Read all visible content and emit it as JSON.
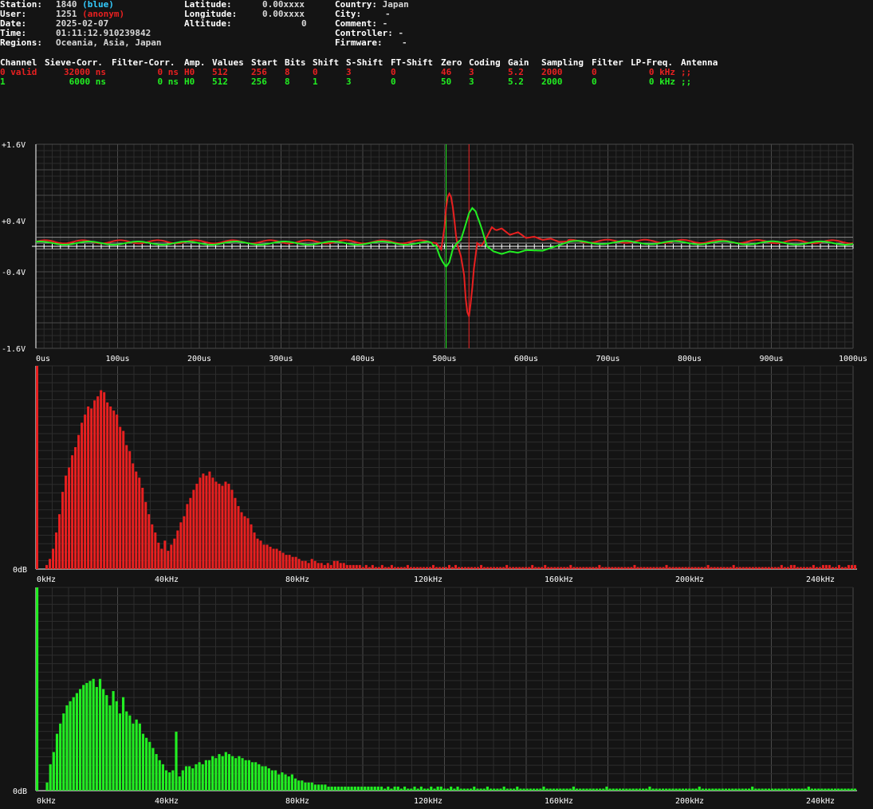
{
  "station": {
    "station_label": "Station:",
    "station_value": "1840",
    "station_tag": "(blue)",
    "user_label": "User:",
    "user_value": "1251",
    "user_tag": "(anonym)",
    "date_label": "Date:",
    "date_value": "2025-02-07",
    "time_label": "Time:",
    "time_value": "01:11:12.910239842",
    "regions_label": "Regions:",
    "regions_value": "Oceania, Asia, Japan",
    "latitude_label": "Latitude:",
    "latitude_value": "0.00xxxx",
    "longitude_label": "Longitude:",
    "longitude_value": "0.00xxxx",
    "altitude_label": "Altitude:",
    "altitude_value": "0",
    "country_label": "Country:",
    "country_value": "Japan",
    "city_label": "City:",
    "city_value": "-",
    "comment_label": "Comment:",
    "comment_value": "-",
    "controller_label": "Controller:",
    "controller_value": "-",
    "firmware_label": "Firmware:",
    "firmware_value": "-"
  },
  "channels": {
    "headers": [
      "Channel",
      "Sieve-Corr.",
      "Filter-Corr.",
      "Amp.",
      "Values",
      "Start",
      "Bits",
      "Shift",
      "S-Shift",
      "FT-Shift",
      "Zero",
      "Coding",
      "Gain",
      "Sampling",
      "Filter",
      "LP-Freq.",
      "Antenna"
    ],
    "rows": [
      {
        "color": "#e82020",
        "cells": [
          "0 valid",
          "32000 ns",
          "0 ns",
          "H0",
          "512",
          "256",
          "8",
          "0",
          "3",
          "0",
          "46",
          "3",
          "5.2",
          "2000",
          "0",
          "0 kHz",
          ";;"
        ]
      },
      {
        "color": "#22ee22",
        "cells": [
          "1",
          "6000 ns",
          "0 ns",
          "H0",
          "512",
          "256",
          "8",
          "1",
          "3",
          "0",
          "50",
          "3",
          "5.2",
          "2000",
          "0",
          "0 kHz",
          ";;"
        ]
      }
    ]
  },
  "colors": {
    "ch0": "#e82020",
    "ch1": "#22ee22",
    "grid": "#3a3a3a",
    "background": "#141414"
  },
  "chart_data": [
    {
      "type": "line",
      "x_unit": "us",
      "xlim": [
        0,
        1000
      ],
      "ylim": [
        -1.6,
        1.6
      ],
      "y_tick_labels": [
        {
          "value": 1.6,
          "label": "+1.6V"
        },
        {
          "value": 0.4,
          "label": "+0.4V"
        },
        {
          "value": -0.4,
          "label": "-0.4V"
        },
        {
          "value": -1.6,
          "label": "-1.6V"
        }
      ],
      "x_tick_labels": [
        "0us",
        "100us",
        "200us",
        "300us",
        "400us",
        "500us",
        "600us",
        "700us",
        "800us",
        "900us",
        "1000us"
      ],
      "markers_us": [
        {
          "x": 502,
          "color": "#22ee22"
        },
        {
          "x": 530,
          "color": "#e82020"
        }
      ],
      "series": [
        {
          "color": "#e82020",
          "x": [
            0,
            480,
            490,
            496,
            500,
            503,
            507,
            511,
            515,
            520,
            524,
            527,
            530,
            533,
            536,
            540,
            545,
            552,
            558,
            563,
            570,
            580,
            590,
            600,
            610,
            620,
            630,
            640,
            660,
            1000
          ],
          "y": [
            0.07,
            0.07,
            0.05,
            -0.05,
            0.3,
            0.75,
            0.85,
            0.55,
            0.05,
            -0.15,
            -0.45,
            -1.0,
            -1.1,
            -0.8,
            -0.35,
            0.05,
            0.0,
            0.15,
            0.3,
            0.25,
            0.28,
            0.18,
            0.22,
            0.13,
            0.15,
            0.1,
            0.12,
            0.07,
            0.08,
            0.07
          ]
        },
        {
          "color": "#22ee22",
          "x": [
            0,
            480,
            490,
            494,
            498,
            502,
            506,
            510,
            515,
            520,
            525,
            530,
            534,
            538,
            545,
            552,
            560,
            570,
            580,
            590,
            600,
            620,
            650,
            1000
          ],
          "y": [
            0.05,
            0.05,
            0.0,
            -0.15,
            -0.25,
            -0.32,
            -0.25,
            -0.05,
            0.05,
            0.1,
            0.3,
            0.52,
            0.6,
            0.55,
            0.3,
            0.0,
            -0.08,
            -0.12,
            -0.08,
            -0.1,
            -0.06,
            -0.07,
            0.06,
            0.05
          ]
        }
      ]
    },
    {
      "type": "bar",
      "x_unit": "kHz",
      "xlim": [
        0,
        250
      ],
      "y_min_label": "0dB",
      "x_tick_labels": [
        "0kHz",
        "40kHz",
        "80kHz",
        "120kHz",
        "160kHz",
        "200kHz",
        "240kHz"
      ],
      "color": "#e82020",
      "values": [
        1.0,
        0.0,
        0.0,
        0.02,
        0.05,
        0.1,
        0.18,
        0.27,
        0.38,
        0.46,
        0.5,
        0.56,
        0.6,
        0.66,
        0.72,
        0.76,
        0.8,
        0.79,
        0.83,
        0.85,
        0.88,
        0.87,
        0.82,
        0.8,
        0.78,
        0.76,
        0.7,
        0.68,
        0.61,
        0.58,
        0.52,
        0.48,
        0.45,
        0.4,
        0.33,
        0.27,
        0.22,
        0.18,
        0.13,
        0.1,
        0.14,
        0.09,
        0.12,
        0.15,
        0.19,
        0.23,
        0.26,
        0.32,
        0.35,
        0.39,
        0.42,
        0.45,
        0.47,
        0.46,
        0.48,
        0.45,
        0.43,
        0.42,
        0.41,
        0.43,
        0.42,
        0.39,
        0.35,
        0.31,
        0.28,
        0.26,
        0.25,
        0.22,
        0.18,
        0.15,
        0.14,
        0.12,
        0.12,
        0.11,
        0.1,
        0.1,
        0.09,
        0.08,
        0.07,
        0.07,
        0.06,
        0.06,
        0.05,
        0.04,
        0.04,
        0.03,
        0.05,
        0.04,
        0.03,
        0.03,
        0.02,
        0.03,
        0.02,
        0.04,
        0.04,
        0.03,
        0.03,
        0.02,
        0.02,
        0.02,
        0.02,
        0.02,
        0.01,
        0.02,
        0.01,
        0.02,
        0.01,
        0.01,
        0.02,
        0.01,
        0.01,
        0.02,
        0.01,
        0.01,
        0.01,
        0.01,
        0.02,
        0.01,
        0.01,
        0.01,
        0.01,
        0.01,
        0.01,
        0.01,
        0.02,
        0.01,
        0.01,
        0.01,
        0.01,
        0.02,
        0.01,
        0.02,
        0.01,
        0.01,
        0.01,
        0.01,
        0.01,
        0.01,
        0.01,
        0.02,
        0.01,
        0.01,
        0.01,
        0.01,
        0.01,
        0.01,
        0.01,
        0.02,
        0.01,
        0.01,
        0.01,
        0.01,
        0.01,
        0.01,
        0.01,
        0.02,
        0.01,
        0.01,
        0.01,
        0.02,
        0.01,
        0.01,
        0.01,
        0.01,
        0.01,
        0.01,
        0.01,
        0.02,
        0.01,
        0.01,
        0.01,
        0.01,
        0.01,
        0.01,
        0.01,
        0.01,
        0.02,
        0.01,
        0.01,
        0.01,
        0.01,
        0.01,
        0.01,
        0.01,
        0.01,
        0.01,
        0.01,
        0.02,
        0.01,
        0.01,
        0.01,
        0.01,
        0.01,
        0.01,
        0.01,
        0.01,
        0.01,
        0.02,
        0.01,
        0.01,
        0.01,
        0.01,
        0.01,
        0.01,
        0.01,
        0.01,
        0.01,
        0.01,
        0.01,
        0.01,
        0.02,
        0.01,
        0.01,
        0.01,
        0.01,
        0.01,
        0.01,
        0.01,
        0.02,
        0.01,
        0.01,
        0.01,
        0.01,
        0.01,
        0.01,
        0.01,
        0.01,
        0.01,
        0.01,
        0.01,
        0.01,
        0.01,
        0.01,
        0.02,
        0.01,
        0.01,
        0.02,
        0.02,
        0.01,
        0.01,
        0.01,
        0.01,
        0.01,
        0.02,
        0.01,
        0.01,
        0.02,
        0.02,
        0.02,
        0.01,
        0.01,
        0.02,
        0.01,
        0.01,
        0.02,
        0.02,
        0.02
      ]
    },
    {
      "type": "bar",
      "x_unit": "kHz",
      "xlim": [
        0,
        250
      ],
      "y_min_label": "0dB",
      "x_tick_labels": [
        "0kHz",
        "40kHz",
        "80kHz",
        "120kHz",
        "160kHz",
        "200kHz",
        "240kHz"
      ],
      "color": "#22ee22",
      "values": [
        1.0,
        0.0,
        0.0,
        0.04,
        0.13,
        0.19,
        0.28,
        0.33,
        0.38,
        0.42,
        0.44,
        0.46,
        0.48,
        0.5,
        0.52,
        0.53,
        0.54,
        0.55,
        0.51,
        0.55,
        0.5,
        0.47,
        0.42,
        0.49,
        0.44,
        0.38,
        0.46,
        0.39,
        0.37,
        0.33,
        0.35,
        0.33,
        0.28,
        0.26,
        0.24,
        0.21,
        0.18,
        0.15,
        0.13,
        0.1,
        0.09,
        0.1,
        0.29,
        0.07,
        0.1,
        0.12,
        0.12,
        0.11,
        0.13,
        0.14,
        0.13,
        0.15,
        0.15,
        0.17,
        0.16,
        0.18,
        0.17,
        0.19,
        0.18,
        0.17,
        0.16,
        0.17,
        0.16,
        0.15,
        0.15,
        0.14,
        0.14,
        0.13,
        0.12,
        0.12,
        0.11,
        0.1,
        0.1,
        0.08,
        0.09,
        0.08,
        0.07,
        0.08,
        0.06,
        0.05,
        0.05,
        0.04,
        0.04,
        0.04,
        0.03,
        0.03,
        0.03,
        0.03,
        0.02,
        0.02,
        0.02,
        0.02,
        0.02,
        0.02,
        0.02,
        0.02,
        0.02,
        0.02,
        0.02,
        0.02,
        0.02,
        0.02,
        0.02,
        0.02,
        0.02,
        0.01,
        0.02,
        0.01,
        0.02,
        0.02,
        0.01,
        0.02,
        0.01,
        0.01,
        0.02,
        0.01,
        0.02,
        0.01,
        0.01,
        0.02,
        0.01,
        0.02,
        0.02,
        0.01,
        0.01,
        0.02,
        0.01,
        0.02,
        0.01,
        0.01,
        0.01,
        0.01,
        0.02,
        0.01,
        0.01,
        0.01,
        0.02,
        0.01,
        0.01,
        0.01,
        0.01,
        0.02,
        0.01,
        0.01,
        0.01,
        0.02,
        0.01,
        0.01,
        0.01,
        0.01,
        0.01,
        0.01,
        0.01,
        0.02,
        0.01,
        0.01,
        0.01,
        0.01,
        0.01,
        0.01,
        0.01,
        0.01,
        0.02,
        0.01,
        0.01,
        0.01,
        0.01,
        0.01,
        0.01,
        0.01,
        0.01,
        0.01,
        0.02,
        0.01,
        0.01,
        0.01,
        0.01,
        0.01,
        0.01,
        0.01,
        0.01,
        0.01,
        0.01,
        0.01,
        0.01,
        0.02,
        0.01,
        0.01,
        0.01,
        0.01,
        0.01,
        0.01,
        0.01,
        0.01,
        0.01,
        0.01,
        0.01,
        0.01,
        0.01,
        0.01,
        0.02,
        0.01,
        0.01,
        0.01,
        0.01,
        0.01,
        0.01,
        0.01,
        0.01,
        0.01,
        0.01,
        0.01,
        0.01,
        0.01,
        0.01,
        0.01,
        0.02,
        0.01,
        0.01,
        0.01,
        0.01,
        0.01,
        0.01,
        0.01,
        0.01,
        0.01,
        0.01,
        0.01,
        0.01,
        0.01,
        0.01,
        0.01,
        0.01,
        0.02,
        0.01,
        0.01,
        0.01,
        0.01,
        0.01,
        0.01,
        0.01,
        0.01,
        0.01,
        0.01,
        0.01,
        0.01,
        0.01,
        0.01
      ]
    }
  ]
}
